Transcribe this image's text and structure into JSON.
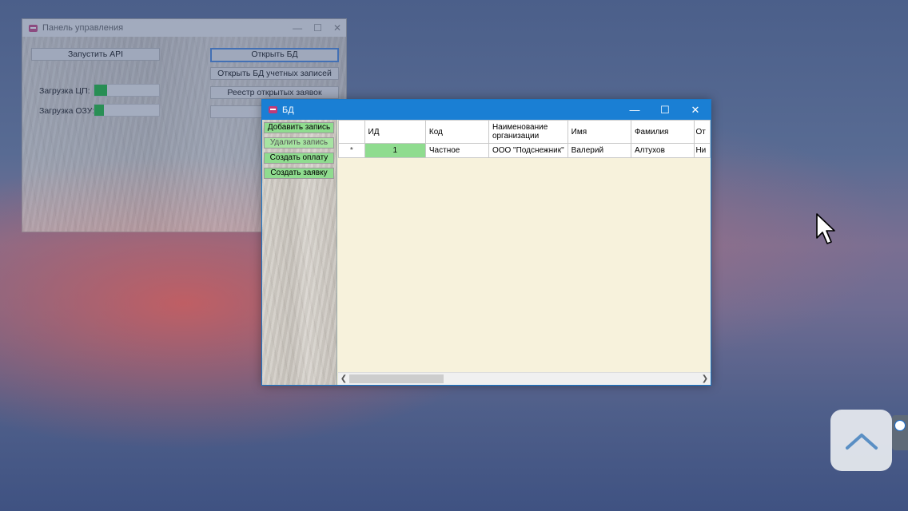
{
  "control_panel": {
    "title": "Панель управления",
    "start_api": "Запустить API",
    "open_db": "Открыть БД",
    "open_accounts_db": "Открыть БД учетных записей",
    "open_requests_registry": "Реестр открытых заявок",
    "cpu_label": "Загрузка ЦП:",
    "ram_label": "Загрузка ОЗУ:",
    "cpu_load": 0.2,
    "ram_load": 0.15
  },
  "db_window": {
    "title": "БД",
    "buttons": {
      "add": "Добавить запись",
      "delete": "Удалить запись",
      "payment": "Создать оплату",
      "request": "Создать заявку"
    },
    "grid": {
      "columns": [
        "ИД",
        "Код",
        "Наименование организации",
        "Имя",
        "Фамилия",
        "От"
      ],
      "rows": [
        {
          "marker": "*",
          "cells": [
            "1",
            "Частное",
            "ООО \"Подснежник\"",
            "Валерий",
            "Алтухов",
            "Ни"
          ]
        }
      ]
    }
  },
  "colors": {
    "accent": "#1a7fd4",
    "green_button": "#8fdc8f",
    "progress": "#06b025"
  },
  "icons": {
    "scroll_top": "chevron-up-icon",
    "cursor": "mouse-pointer-icon"
  }
}
